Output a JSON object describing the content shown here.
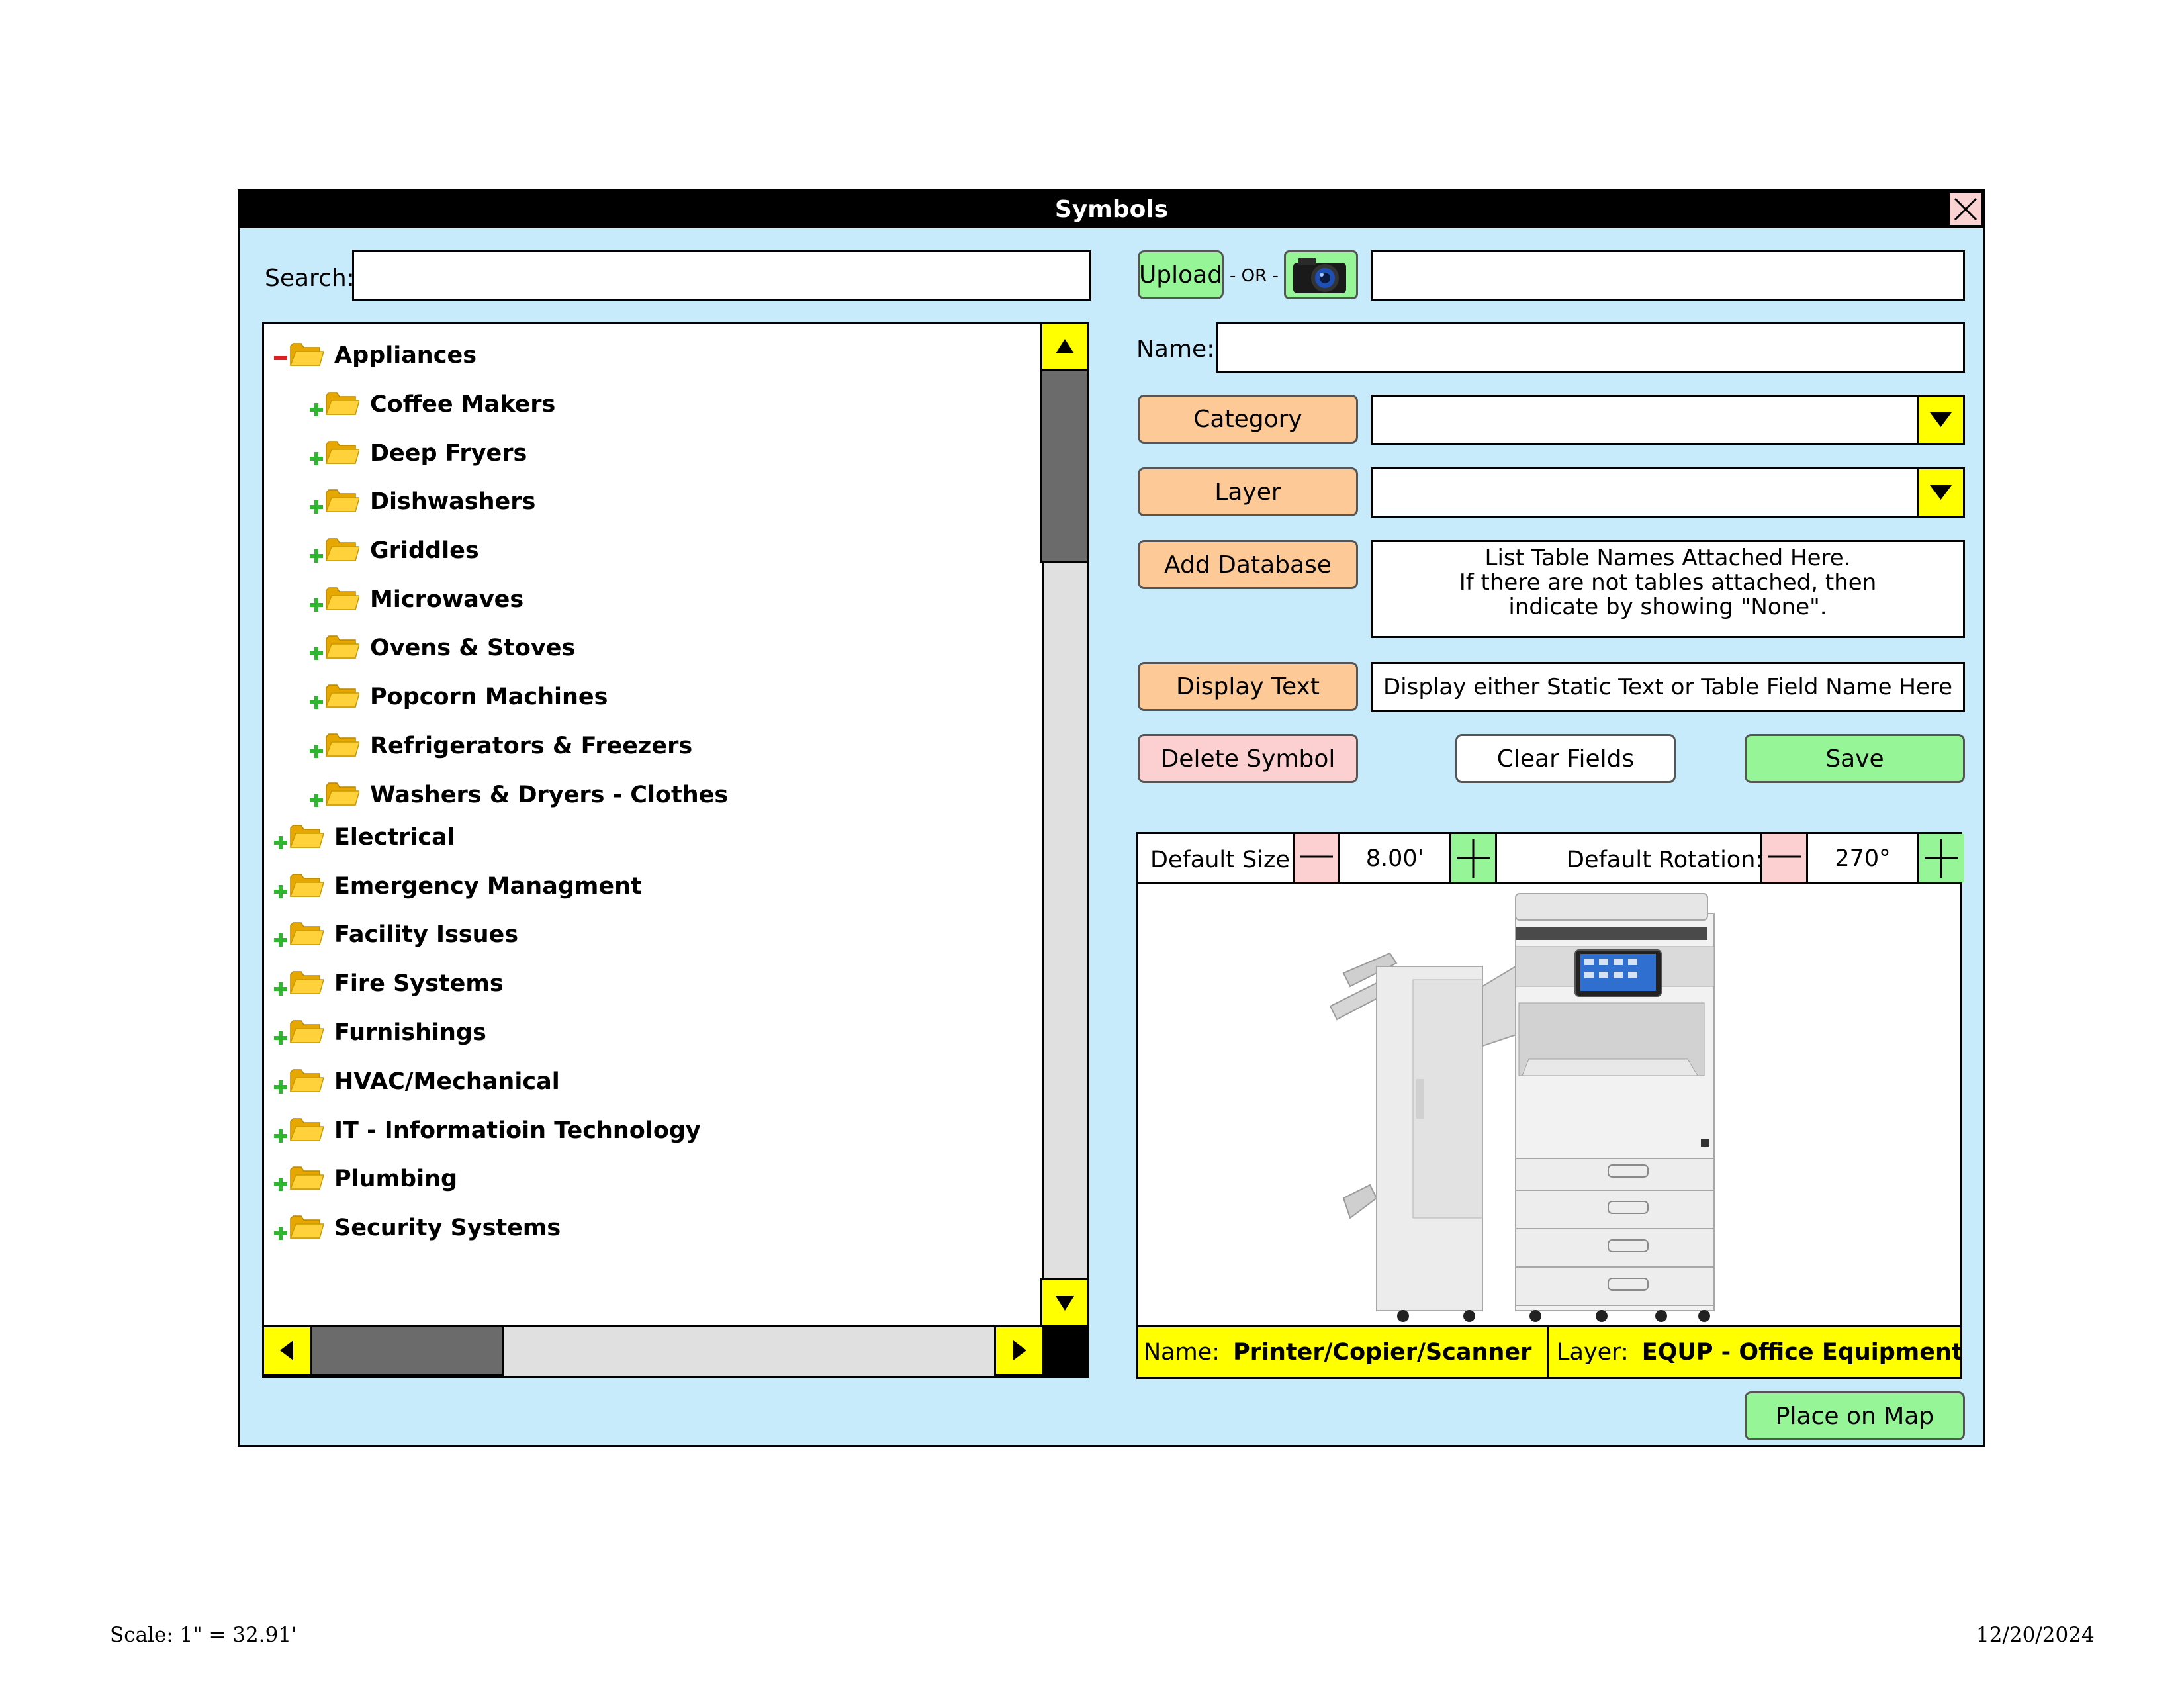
{
  "dialog": {
    "title": "Symbols"
  },
  "search": {
    "label": "Search:",
    "value": ""
  },
  "tree": {
    "items": [
      {
        "label": "Appliances",
        "level": 0,
        "expanded": true
      },
      {
        "label": "Coffee Makers",
        "level": 1,
        "expanded": false
      },
      {
        "label": "Deep Fryers",
        "level": 1,
        "expanded": false
      },
      {
        "label": "Dishwashers",
        "level": 1,
        "expanded": false
      },
      {
        "label": "Griddles",
        "level": 1,
        "expanded": false
      },
      {
        "label": "Microwaves",
        "level": 1,
        "expanded": false
      },
      {
        "label": "Ovens & Stoves",
        "level": 1,
        "expanded": false
      },
      {
        "label": "Popcorn Machines",
        "level": 1,
        "expanded": false
      },
      {
        "label": "Refrigerators & Freezers",
        "level": 1,
        "expanded": false
      },
      {
        "label": "Washers & Dryers - Clothes",
        "level": 1,
        "expanded": false
      },
      {
        "label": "Electrical",
        "level": 0,
        "expanded": false
      },
      {
        "label": "Emergency Managment",
        "level": 0,
        "expanded": false
      },
      {
        "label": "Facility Issues",
        "level": 0,
        "expanded": false
      },
      {
        "label": "Fire Systems",
        "level": 0,
        "expanded": false
      },
      {
        "label": "Furnishings",
        "level": 0,
        "expanded": false
      },
      {
        "label": "HVAC/Mechanical",
        "level": 0,
        "expanded": false
      },
      {
        "label": "IT - Informatioin Technology",
        "level": 0,
        "expanded": false
      },
      {
        "label": "Plumbing",
        "level": 0,
        "expanded": false
      },
      {
        "label": "Security Systems",
        "level": 0,
        "expanded": false
      }
    ]
  },
  "upload": {
    "button_label": "Upload",
    "or_text": "- OR -",
    "camera_icon": "camera-icon",
    "path_value": ""
  },
  "name_field": {
    "label": "Name:",
    "value": ""
  },
  "category": {
    "button_label": "Category",
    "value": ""
  },
  "layer": {
    "button_label": "Layer",
    "value": ""
  },
  "database": {
    "button_label": "Add Database",
    "info_line1": "List Table Names Attached Here.",
    "info_line2": "If there are not tables attached, then",
    "info_line3": "indicate by showing \"None\"."
  },
  "display_text": {
    "button_label": "Display Text",
    "value": "Display either Static Text or Table Field Name Here"
  },
  "actions": {
    "delete_label": "Delete Symbol",
    "clear_label": "Clear Fields",
    "save_label": "Save"
  },
  "preview": {
    "size_label": "Default Size:",
    "size_value": "8.00'",
    "rotation_label": "Default Rotation:",
    "rotation_value": "270°",
    "name_label": "Name:",
    "name_value": "Printer/Copier/Scanner",
    "layer_label": "Layer:",
    "layer_value": "EQUP - Office Equipment"
  },
  "place_on_map_label": "Place on Map",
  "footer": {
    "scale": "Scale: 1\" = 32.91'",
    "date": "12/20/2024"
  },
  "colors": {
    "panel": "#c8ebfb",
    "accent_yellow": "#ffff00",
    "orange_button": "#fcc997",
    "green_button": "#95f597",
    "pink_button": "#fcd0d0"
  }
}
